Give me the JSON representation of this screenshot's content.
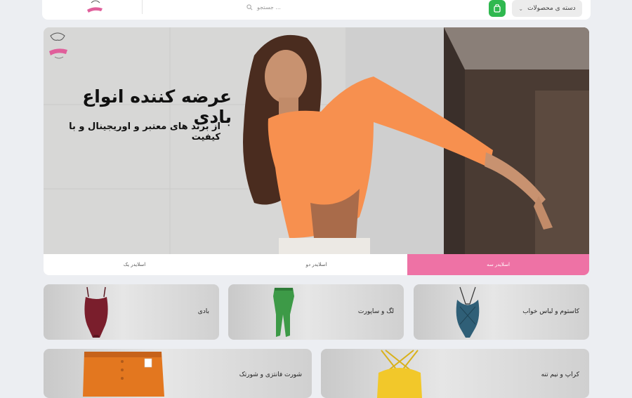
{
  "header": {
    "categories_button": "دسته ی محصولات",
    "search_placeholder": "جستجو ..."
  },
  "hero": {
    "title": "عرضه کننده انواع بادی",
    "subtitle": "از برند های معتبر و اوریجینال و با کیفیت"
  },
  "slider_tabs": [
    {
      "label": "اسلایدر یک",
      "active": false
    },
    {
      "label": "اسلایدر دو",
      "active": false
    },
    {
      "label": "اسلایدر سه",
      "active": true
    }
  ],
  "categories": [
    {
      "label": "کاستوم و لباس خواب",
      "icon": "lace-bodysuit-icon"
    },
    {
      "label": "لگ و ساپورت",
      "icon": "green-leggings-icon"
    },
    {
      "label": "بادی",
      "icon": "maroon-bodysuit-icon"
    },
    {
      "label": "کراپ و نیم تنه",
      "icon": "yellow-crop-top-icon"
    },
    {
      "label": "شورت فانتزی و شورتک",
      "icon": "orange-shorts-icon"
    }
  ],
  "colors": {
    "accent_pink": "#ee72a5",
    "cart_green": "#2fb84f",
    "shirt_orange": "#f7904f"
  }
}
